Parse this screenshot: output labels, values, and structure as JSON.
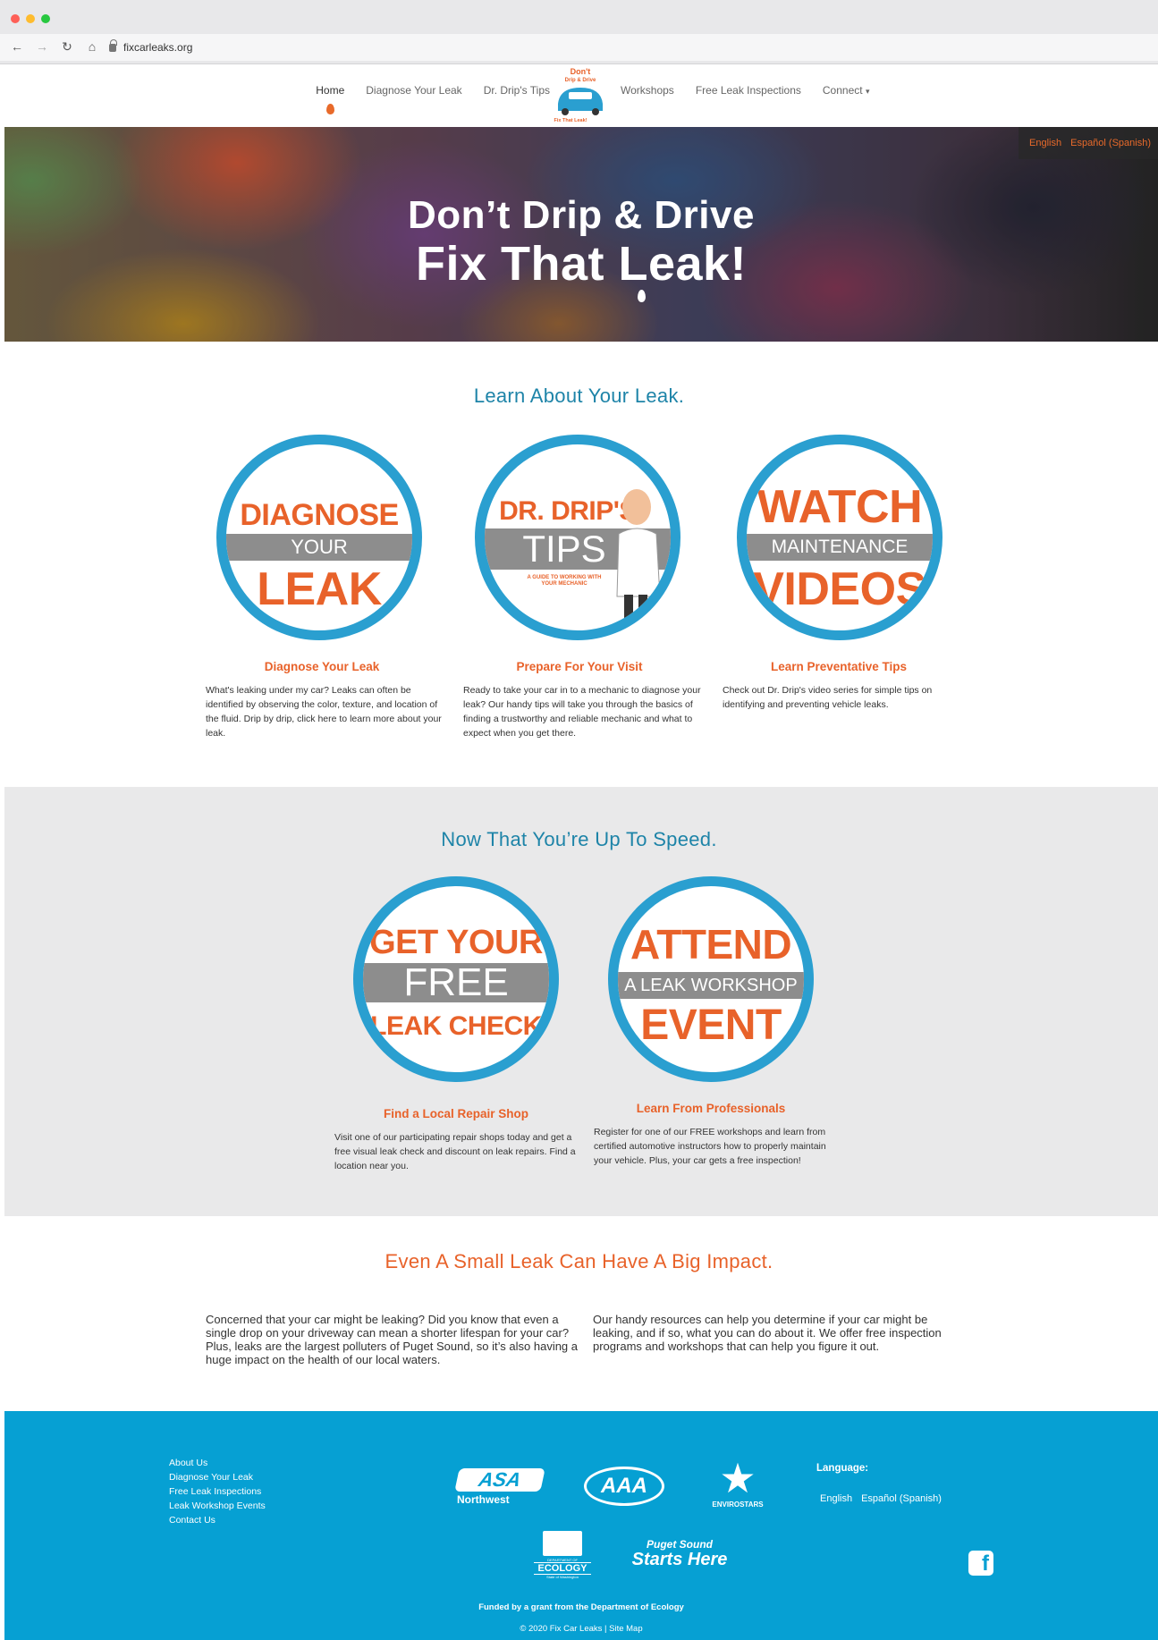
{
  "browser": {
    "url": "fixcarleaks.org"
  },
  "nav": {
    "home": "Home",
    "diagnose": "Diagnose Your Leak",
    "tips": "Dr. Drip's Tips",
    "workshops": "Workshops",
    "inspections": "Free Leak Inspections",
    "connect": "Connect",
    "logo_top": "Don't",
    "logo_mid": "Drip & Drive",
    "logo_bottom": "Fix That Leak!"
  },
  "hero": {
    "line1": "Don’t Drip & Drive",
    "line2": "Fix That Leak!",
    "lang_english": "English",
    "lang_spanish": "Español (Spanish)"
  },
  "learn": {
    "title": "Learn About Your Leak.",
    "cards": [
      {
        "top": "DIAGNOSE",
        "band": "YOUR",
        "bottom": "LEAK",
        "heading": "Diagnose Your Leak",
        "text": "What's leaking under my car? Leaks can often be identified by observing the color, texture, and location of the fluid. Drip by drip, click here to learn more about your leak."
      },
      {
        "top": "DR. DRIP'S",
        "band": "TIPS",
        "bottom": "A GUIDE TO WORKING WITH YOUR MECHANIC",
        "heading": "Prepare For Your Visit",
        "text": "Ready to take your car in to a mechanic to diagnose your leak? Our handy tips will take you through the basics of finding a trustworthy and reliable mechanic and what to expect when you get there."
      },
      {
        "top": "WATCH",
        "band": "MAINTENANCE",
        "bottom": "VIDEOS",
        "heading": "Learn Preventative Tips",
        "text": "Check out Dr. Drip's video series for simple tips on identifying and preventing vehicle leaks."
      }
    ]
  },
  "speed": {
    "title": "Now That You’re Up To Speed.",
    "cards": [
      {
        "top": "GET YOUR",
        "band": "FREE",
        "bottom": "LEAK CHECK",
        "heading": "Find a Local Repair Shop",
        "text": "Visit one of our participating repair shops today and get a free visual leak check and discount on leak repairs. Find a location near you."
      },
      {
        "top": "ATTEND",
        "band": "A LEAK WORKSHOP",
        "bottom": "EVENT",
        "heading": "Learn From Professionals",
        "text": "Register for one of our FREE workshops and learn from certified automotive instructors how to properly maintain your vehicle. Plus, your car gets a free inspection!"
      }
    ]
  },
  "impact": {
    "title": "Even A Small Leak Can Have A Big Impact.",
    "left": "Concerned that your car might be leaking? Did you know that even a single drop on your driveway can mean a shorter lifespan for your car? Plus, leaks are the largest polluters of Puget Sound, so it’s also having a huge impact on the health of our local waters.",
    "right": "Our handy resources can help you determine if your car might be leaking, and if so, what you can do about it. We offer free inspection programs and workshops that can help you figure it out."
  },
  "footer": {
    "links": [
      "About Us",
      "Diagnose Your Leak",
      "Free Leak Inspections",
      "Leak Workshop Events",
      "Contact Us"
    ],
    "asa": "ASA",
    "asa_sub": "Northwest",
    "aaa": "AAA",
    "envirostars": "ENVIROSTARS",
    "ecology": "ECOLOGY",
    "ecology_top": "DEPARTMENT OF",
    "ecology_sub": "State of Washington",
    "puget1": "Puget Sound",
    "puget2": "Starts Here",
    "language_title": "Language:",
    "lang_english": "English",
    "lang_spanish": "Español (Spanish)",
    "facebook_icon": "facebook-icon",
    "funded": "Funded by a grant from the Department of Ecology",
    "copyright": "© 2020 Fix Car Leaks | Site Map"
  },
  "colors": {
    "accent_orange": "#e8622a",
    "accent_blue": "#2a9fd0",
    "title_blue": "#1e84a8",
    "footer_blue": "#06a0d3"
  }
}
